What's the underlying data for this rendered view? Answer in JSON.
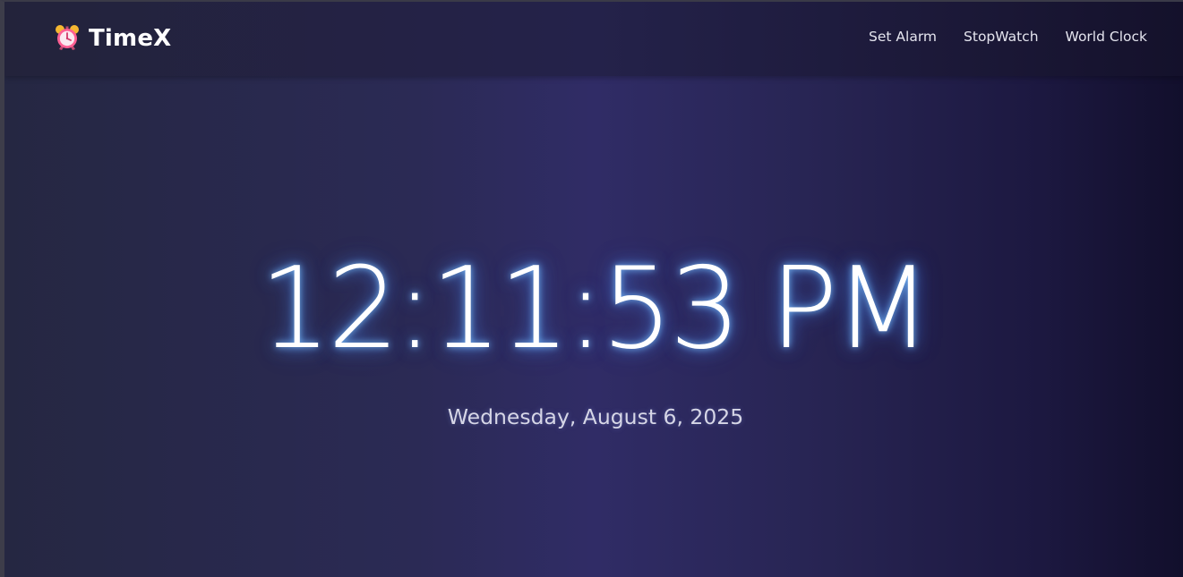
{
  "brand": {
    "icon": "alarm-clock-icon",
    "name": "TimeX"
  },
  "nav": {
    "links": [
      {
        "label": "Set Alarm"
      },
      {
        "label": "StopWatch"
      },
      {
        "label": "World Clock"
      }
    ]
  },
  "clock": {
    "time": "12:11:53 PM",
    "date": "Wednesday, August 6, 2025"
  },
  "colors": {
    "background_start": "#252742",
    "background_mid": "#302c66",
    "background_end": "#120f2c",
    "navbar": "#23233b",
    "text": "#ffffff",
    "glow": "#78beff",
    "icon_accent": "#ff5f93"
  }
}
